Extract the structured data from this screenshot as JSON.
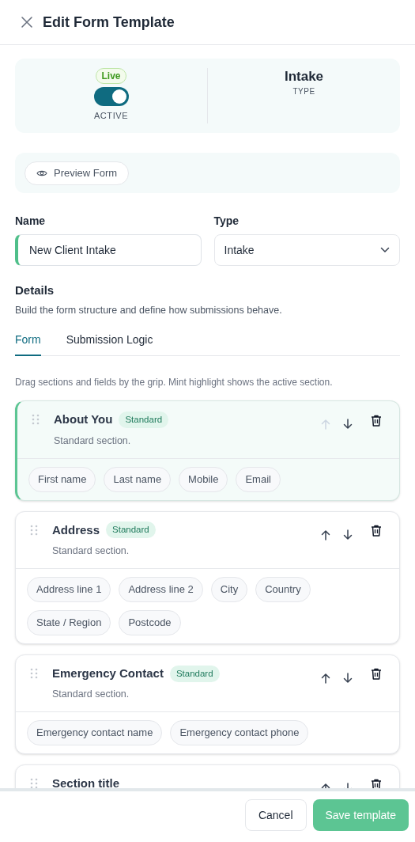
{
  "header": {
    "title": "Edit Form Template"
  },
  "status": {
    "badge": "Live",
    "active": true,
    "toggle_label": "ACTIVE",
    "type_value": "Intake",
    "type_label": "TYPE"
  },
  "preview_button": "Preview Form",
  "fields": [
    {
      "label": "Name",
      "value": "New Client Intake",
      "kind": "text",
      "focused": true
    },
    {
      "label": "Type",
      "value": "Intake",
      "kind": "select",
      "focused": false
    }
  ],
  "details": {
    "title": "Details",
    "description": "Build the form structure and define how submissions behave."
  },
  "tabs": [
    {
      "label": "Form",
      "selected": true
    },
    {
      "label": "Submission Logic",
      "selected": false
    }
  ],
  "hint": "Drag sections and fields by the grip. Mint highlight shows the active section.",
  "sections": [
    {
      "title": "About You",
      "badge": "Standard",
      "description": "Standard section.",
      "active": true,
      "up_disabled": true,
      "fields": [
        "First name",
        "Last name",
        "Mobile",
        "Email"
      ]
    },
    {
      "title": "Address",
      "badge": "Standard",
      "description": "Standard section.",
      "active": false,
      "up_disabled": false,
      "fields": [
        "Address line 1",
        "Address line 2",
        "City",
        "Country",
        "State / Region",
        "Postcode"
      ]
    },
    {
      "title": "Emergency Contact",
      "badge": "Standard",
      "description": "Standard section.",
      "active": false,
      "up_disabled": false,
      "fields": [
        "Emergency contact name",
        "Emergency contact phone"
      ]
    },
    {
      "title": "Section title",
      "active": false,
      "up_disabled": false
    }
  ],
  "footer": {
    "cancel": "Cancel",
    "save": "Save template"
  }
}
